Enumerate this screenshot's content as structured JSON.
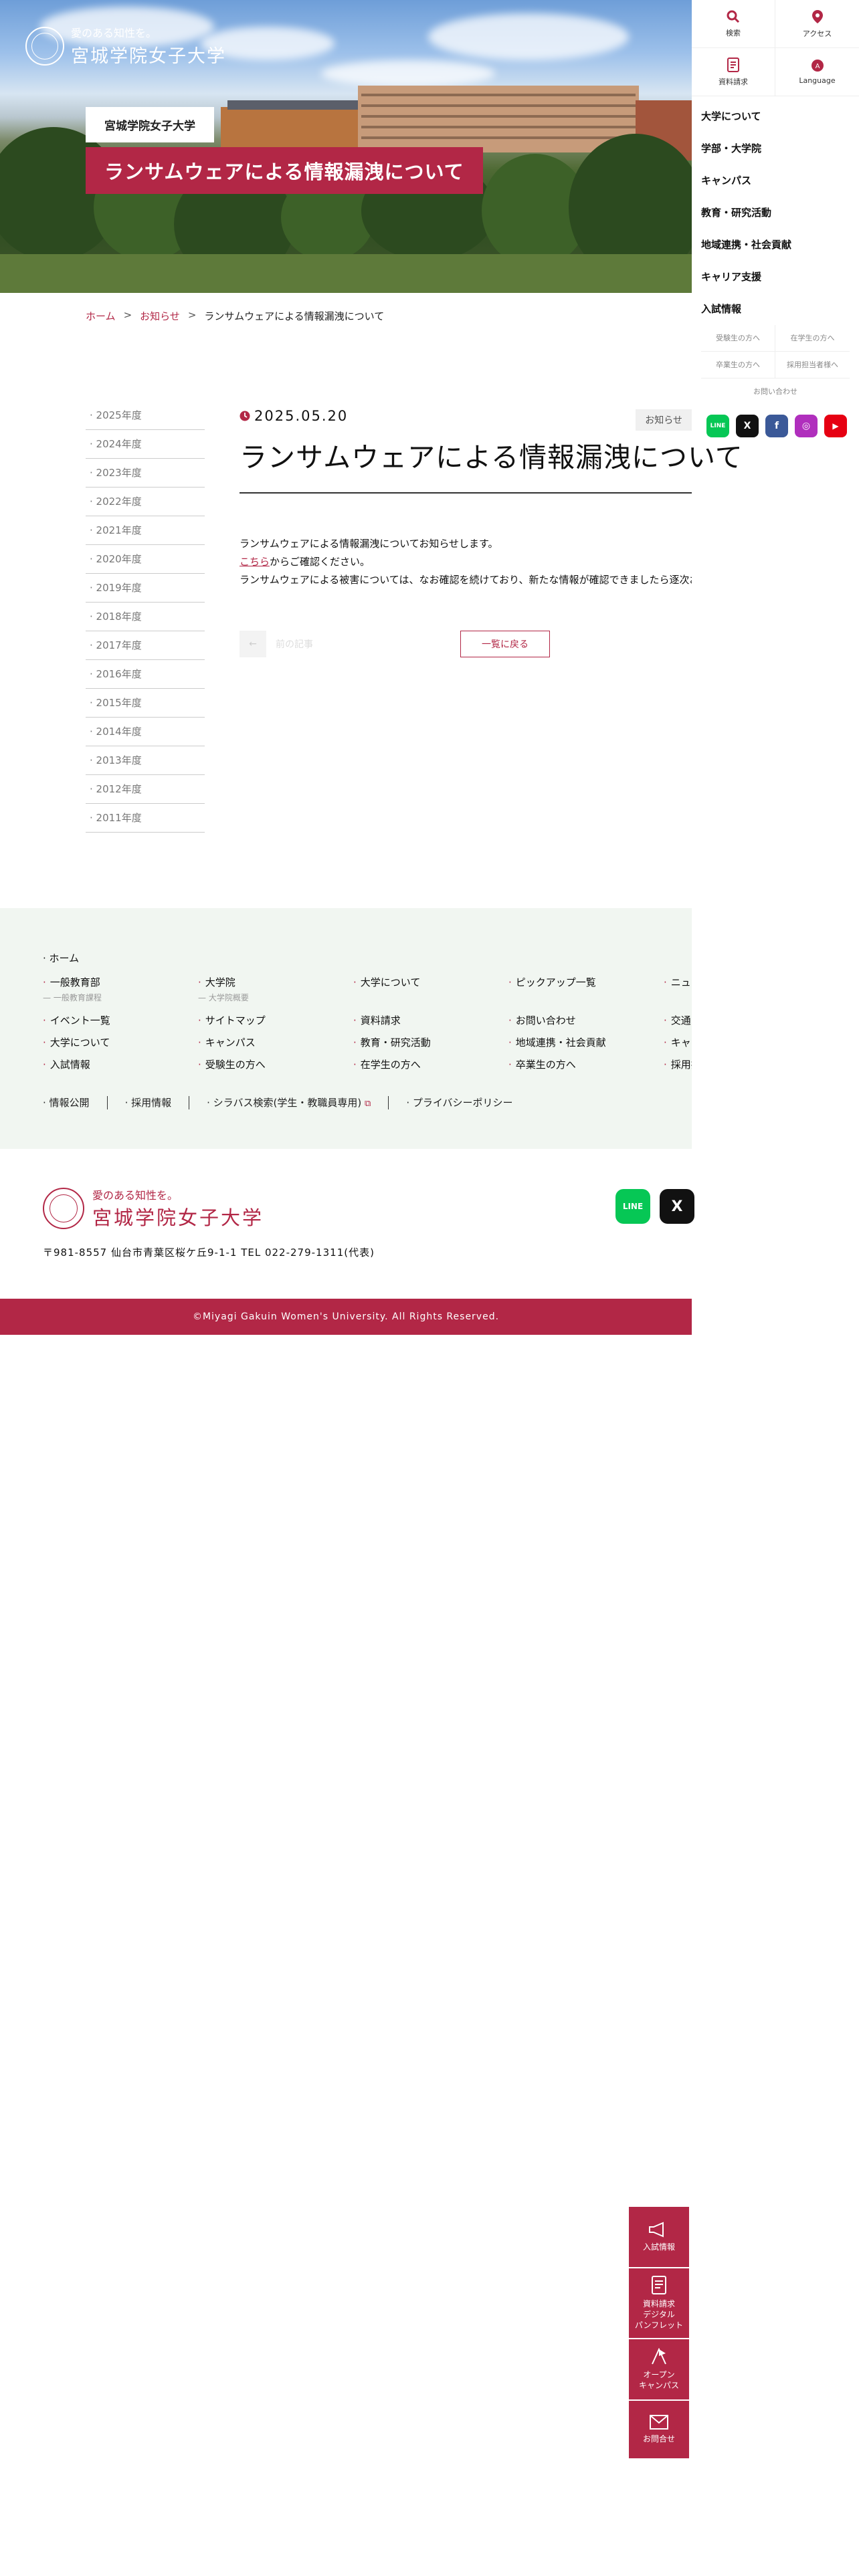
{
  "hero": {
    "logo_tagline": "愛のある知性を。",
    "logo_name": "宮城学院女子大学",
    "subtitle": "宮城学院女子大学",
    "title": "ランサムウェアによる情報漏洩について"
  },
  "rnav": {
    "search_label": "検索",
    "access_label": "アクセス",
    "brochure_label": "資料請求",
    "language_label": "Language",
    "menu": [
      "大学について",
      "学部・大学院",
      "キャンパス",
      "教育・研究活動",
      "地域連携・社会貢献",
      "キャリア支援",
      "入試情報"
    ],
    "sub": [
      "受験生の方へ",
      "在学生の方へ",
      "卒業生の方へ",
      "採用担当者様へ"
    ],
    "contact": "お問い合わせ"
  },
  "breadcrumb": {
    "home": "ホーム",
    "news": "お知らせ",
    "current": "ランサムウェアによる情報漏洩について"
  },
  "years": [
    "2025年度",
    "2024年度",
    "2023年度",
    "2022年度",
    "2021年度",
    "2020年度",
    "2019年度",
    "2018年度",
    "2017年度",
    "2016年度",
    "2015年度",
    "2014年度",
    "2013年度",
    "2012年度",
    "2011年度"
  ],
  "article": {
    "date": "2025.05.20",
    "category": "お知らせ",
    "title": "ランサムウェアによる情報漏洩について",
    "line1": "ランサムウェアによる情報漏洩についてお知らせします。",
    "link_text": "こちら",
    "line2_rest": "からご確認ください。",
    "line3": "ランサムウェアによる被害については、なお確認を続けており、新たな情報が確認できましたら逐次お知らせいたします。",
    "prev_label": "前の記事",
    "back_label": "一覧に戻る"
  },
  "footer_nav": {
    "home": "ホーム",
    "items": [
      {
        "label": "一般教育部",
        "sub": "一般教育課程"
      },
      {
        "label": "大学院",
        "sub": "大学院概要"
      },
      {
        "label": "大学について"
      },
      {
        "label": "ピックアップ一覧"
      },
      {
        "label": "ニュース"
      },
      {
        "label": "イベント一覧"
      },
      {
        "label": "サイトマップ"
      },
      {
        "label": "資料請求"
      },
      {
        "label": "お問い合わせ"
      },
      {
        "label": "交通アクセス"
      },
      {
        "label": "大学について"
      },
      {
        "label": "キャンパス"
      },
      {
        "label": "教育・研究活動"
      },
      {
        "label": "地域連携・社会貢献"
      },
      {
        "label": "キャリア支援"
      },
      {
        "label": "入試情報"
      },
      {
        "label": "受験生の方へ"
      },
      {
        "label": "在学生の方へ"
      },
      {
        "label": "卒業生の方へ"
      },
      {
        "label": "採用担当者様へ"
      }
    ],
    "bottom": [
      "情報公開",
      "採用情報",
      "シラバス検索(学生・教職員専用)",
      "プライバシーポリシー"
    ]
  },
  "footer": {
    "tagline": "愛のある知性を。",
    "name": "宮城学院女子大学",
    "address": "〒981-8557 仙台市青葉区桜ケ丘9-1-1 TEL 022-279-1311(代表)",
    "copyright": "©Miyagi Gakuin Women's University. All Rights Reserved."
  },
  "float_buttons": {
    "admission": "入試情報",
    "brochure_l1": "資料請求",
    "brochure_l2": "デジタル",
    "brochure_l3": "パンフレット",
    "opencampus_l1": "オープン",
    "opencampus_l2": "キャンパス",
    "contact": "お問合せ"
  },
  "sns": {
    "line": "LINE",
    "x": "X",
    "facebook": "f",
    "instagram": "◎",
    "youtube": "▶"
  },
  "colors": {
    "brand": "#b22746",
    "footer_bg": "#f1f6f1"
  }
}
